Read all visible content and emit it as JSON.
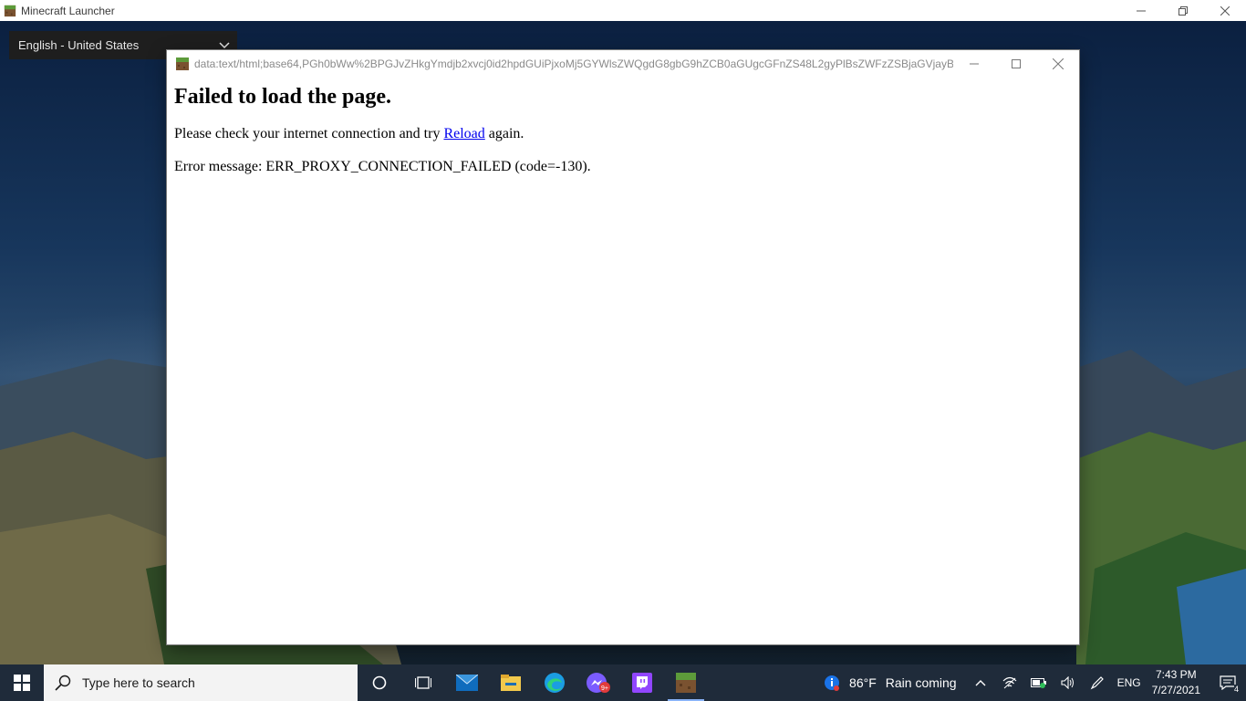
{
  "launcher": {
    "title": "Minecraft Launcher",
    "language_select": {
      "value": "English - United States"
    }
  },
  "dialog": {
    "url": "data:text/html;base64,PGh0bWw%2BPGJvZHkgYmdjb2xvcj0id2hpdGUiPjxoMj5GYWlsZWQgdG8gbG9hZCB0aGUgcGFnZS48L2gyPlBsZWFzZSBjaGVjayB5b3Vy...",
    "heading": "Failed to load the page.",
    "message_prefix": "Please check your internet connection and try ",
    "reload_link": "Reload",
    "message_suffix": " again.",
    "error_message": "Error message: ERR_PROXY_CONNECTION_FAILED (code=-130)."
  },
  "taskbar": {
    "search_placeholder": "Type here to search",
    "apps": [
      "cortana-icon",
      "task-view-icon",
      "mail-icon",
      "file-explorer-icon",
      "edge-icon",
      "messenger-icon",
      "twitch-icon",
      "minecraft-icon"
    ],
    "messenger_badge": "9+",
    "weather_temp": "86°F",
    "weather_condition": "Rain coming",
    "language": "ENG",
    "time": "7:43 PM",
    "date": "7/27/2021",
    "notification_count": "4"
  },
  "colors": {
    "taskbar_bg": "#1f2b3a",
    "link": "#0000ee",
    "twitch": "#9146ff"
  }
}
